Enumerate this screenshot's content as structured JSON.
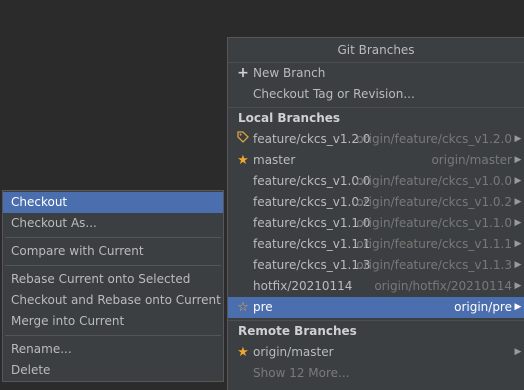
{
  "popup": {
    "title": "Git Branches",
    "actions": [
      {
        "icon": "plus-icon",
        "label": "New Branch"
      },
      {
        "label": "Checkout Tag or Revision..."
      }
    ],
    "local_header": "Local Branches",
    "local_branches": [
      {
        "icon": "tag-icon",
        "name": "feature/ckcs_v1.2.0",
        "tracking": "origin/feature/ckcs_v1.2.0"
      },
      {
        "icon": "star-icon",
        "name": "master",
        "tracking": "origin/master"
      },
      {
        "name": "feature/ckcs_v1.0.0",
        "tracking": "origin/feature/ckcs_v1.0.0"
      },
      {
        "name": "feature/ckcs_v1.0.2",
        "tracking": "origin/feature/ckcs_v1.0.2"
      },
      {
        "name": "feature/ckcs_v1.1.0",
        "tracking": "origin/feature/ckcs_v1.1.0"
      },
      {
        "name": "feature/ckcs_v1.1.1",
        "tracking": "origin/feature/ckcs_v1.1.1"
      },
      {
        "name": "feature/ckcs_v1.1.3",
        "tracking": "origin/feature/ckcs_v1.1.3"
      },
      {
        "name": "hotfix/20210114",
        "tracking": "origin/hotfix/20210114"
      },
      {
        "icon": "star-outline-icon",
        "name": "pre",
        "tracking": "origin/pre",
        "selected": true
      }
    ],
    "remote_header": "Remote Branches",
    "remote_branches": [
      {
        "icon": "star-icon",
        "name": "origin/master"
      }
    ],
    "show_more": "Show 12 More..."
  },
  "context_menu": {
    "groups": [
      [
        {
          "label": "Checkout",
          "selected": true
        },
        {
          "label": "Checkout As..."
        }
      ],
      [
        {
          "label": "Compare with Current"
        }
      ],
      [
        {
          "label": "Rebase Current onto Selected"
        },
        {
          "label": "Checkout and Rebase onto Current"
        },
        {
          "label": "Merge into Current"
        }
      ],
      [
        {
          "label": "Rename..."
        },
        {
          "label": "Delete"
        }
      ]
    ]
  },
  "colors": {
    "background": "#2b2b2b",
    "popup_bg": "#3c3f41",
    "selection": "#4b6eaf",
    "star": "#f0a732"
  }
}
